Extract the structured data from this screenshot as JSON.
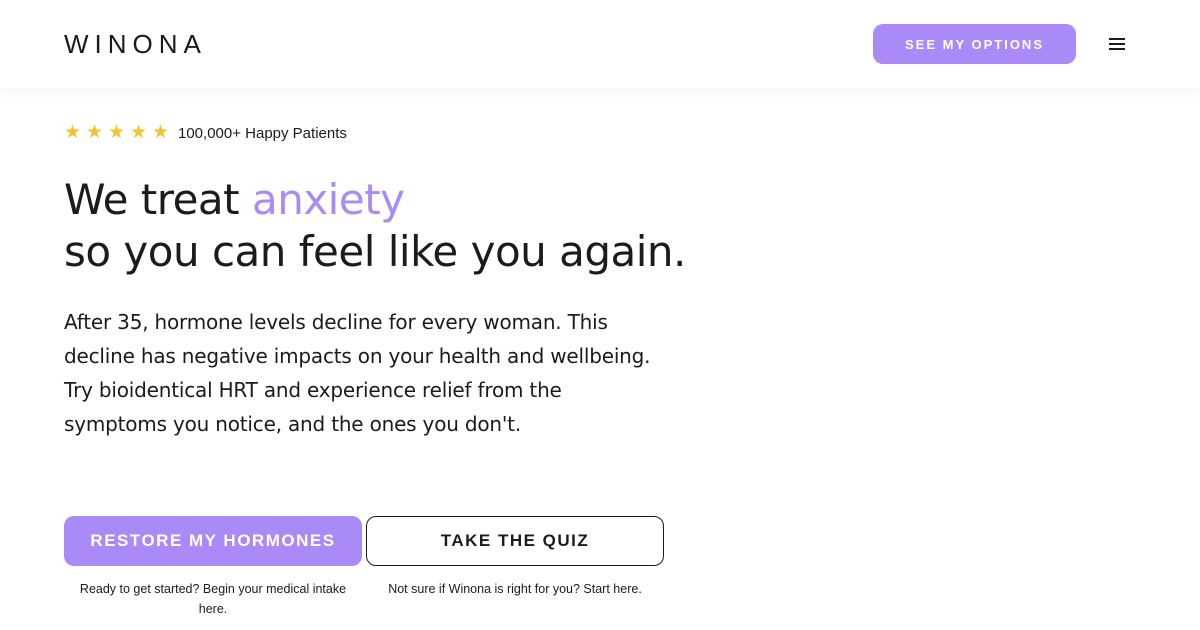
{
  "header": {
    "logo": "WINONA",
    "cta_label": "SEE MY OPTIONS",
    "menu_icon": "hamburger-menu-icon"
  },
  "rating": {
    "stars": 5,
    "star_glyph": "★",
    "text": "100,000+ Happy Patients"
  },
  "hero": {
    "headline_prefix": "We treat ",
    "headline_accent": "anxiety",
    "headline_line2": "so you can feel like you again.",
    "body": "After 35, hormone levels decline for every woman. This decline has negative impacts on your health and wellbeing. Try bioidentical HRT and experience relief from the symptoms you notice, and the ones you don't."
  },
  "actions": {
    "primary_label": "RESTORE MY HORMONES",
    "primary_caption": "Ready to get started? Begin your medical intake here.",
    "secondary_label": "TAKE THE QUIZ",
    "secondary_caption": "Not sure if Winona is right for you? Start here."
  },
  "colors": {
    "accent": "#a98af7",
    "star": "#f4c430",
    "text": "#1b1b1f"
  }
}
